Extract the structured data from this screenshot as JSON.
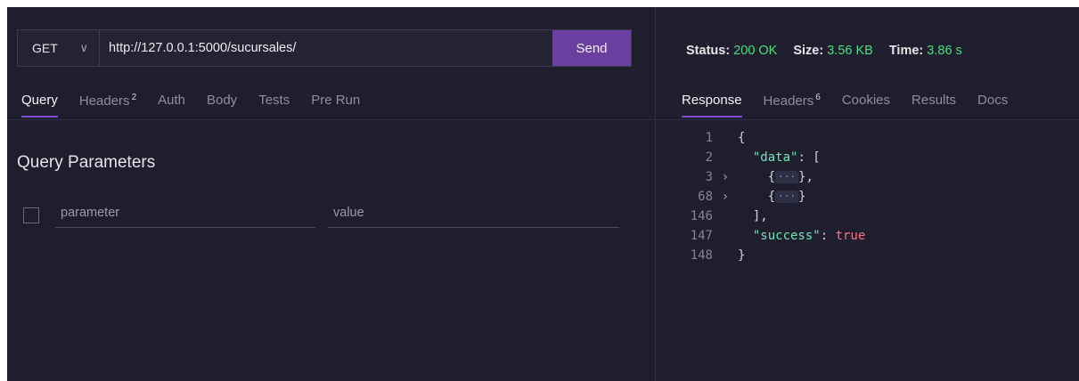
{
  "request": {
    "method": "GET",
    "url": "http://127.0.0.1:5000/sucursales/",
    "send_label": "Send"
  },
  "request_tabs": [
    {
      "label": "Query",
      "count": "",
      "active": true
    },
    {
      "label": "Headers",
      "count": "2",
      "active": false
    },
    {
      "label": "Auth",
      "count": "",
      "active": false
    },
    {
      "label": "Body",
      "count": "",
      "active": false
    },
    {
      "label": "Tests",
      "count": "",
      "active": false
    },
    {
      "label": "Pre Run",
      "count": "",
      "active": false
    }
  ],
  "query": {
    "title": "Query Parameters",
    "param_placeholder": "parameter",
    "value_placeholder": "value"
  },
  "response": {
    "status_label": "Status:",
    "status_value": "200 OK",
    "size_label": "Size:",
    "size_value": "3.56 KB",
    "time_label": "Time:",
    "time_value": "3.86 s"
  },
  "response_tabs": [
    {
      "label": "Response",
      "count": "",
      "active": true
    },
    {
      "label": "Headers",
      "count": "6",
      "active": false
    },
    {
      "label": "Cookies",
      "count": "",
      "active": false
    },
    {
      "label": "Results",
      "count": "",
      "active": false
    },
    {
      "label": "Docs",
      "count": "",
      "active": false
    }
  ],
  "code_lines": [
    {
      "n": "1",
      "fold": "",
      "indent": "",
      "parts": [
        [
          "txt",
          "{"
        ]
      ]
    },
    {
      "n": "2",
      "fold": "",
      "indent": "  ",
      "parts": [
        [
          "key",
          "\"data\""
        ],
        [
          "txt",
          ": ["
        ]
      ]
    },
    {
      "n": "3",
      "fold": "›",
      "indent": "    ",
      "parts": [
        [
          "txt",
          "{"
        ],
        [
          "ell",
          "···"
        ],
        [
          "txt",
          "},"
        ]
      ]
    },
    {
      "n": "68",
      "fold": "›",
      "indent": "    ",
      "parts": [
        [
          "txt",
          "{"
        ],
        [
          "ell",
          "···"
        ],
        [
          "txt",
          "}"
        ]
      ]
    },
    {
      "n": "146",
      "fold": "",
      "indent": "  ",
      "parts": [
        [
          "txt",
          "],"
        ]
      ]
    },
    {
      "n": "147",
      "fold": "",
      "indent": "  ",
      "parts": [
        [
          "key",
          "\"success\""
        ],
        [
          "txt",
          ": "
        ],
        [
          "bool",
          "true"
        ]
      ]
    },
    {
      "n": "148",
      "fold": "",
      "indent": "",
      "parts": [
        [
          "txt",
          "}"
        ]
      ]
    }
  ]
}
